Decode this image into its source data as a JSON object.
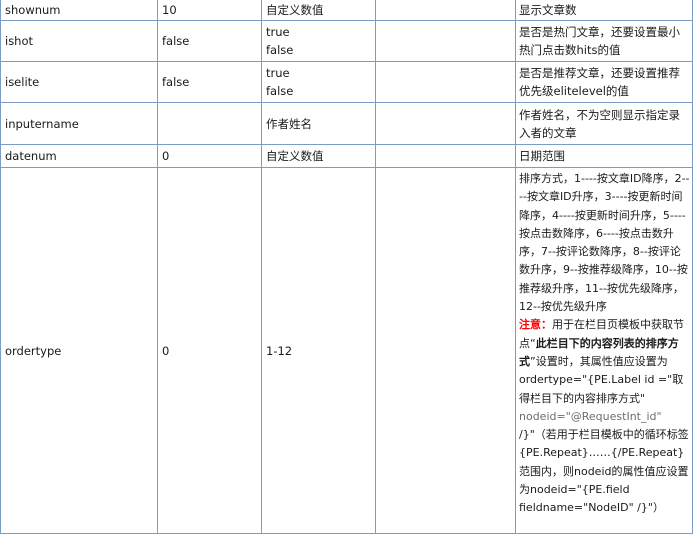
{
  "rows": [
    {
      "name": "shownum",
      "default": "10",
      "values": [
        "自定义数值"
      ],
      "note": "",
      "desc": "显示文章数"
    },
    {
      "name": "ishot",
      "default": "false",
      "values": [
        "true",
        "false"
      ],
      "note": "",
      "desc": "是否是热门文章，还要设置最小热门点击数hits的值"
    },
    {
      "name": "iselite",
      "default": "false",
      "values": [
        "true",
        "false"
      ],
      "note": "",
      "desc": "是否是推荐文章，还要设置推荐优先级elitelevel的值"
    },
    {
      "name": "inputername",
      "default": "",
      "values": [
        "作者姓名"
      ],
      "note": "",
      "desc": "作者姓名，不为空则显示指定录入者的文章"
    },
    {
      "name": "datenum",
      "default": "0",
      "values": [
        "自定义数值"
      ],
      "note": "",
      "desc": "日期范围"
    },
    {
      "name": "ordertype",
      "default": "0",
      "values": [
        "1-12"
      ],
      "note": "",
      "desc": "排序方式，1----按文章ID降序，2----按文章ID升序，3----按更新时间降序，4----按更新时间升序，5----按点击数降序，6----按点击数升序，7--按评论数降序，8--按评论数升序，9--按推荐级降序，10--按推荐级升序，11--按优先级降序，12--按优先级升序",
      "attention_label": "注意：",
      "attention_text_1": "用于在栏目页模板中获取节点“",
      "attention_bold": "此栏目下的内容列表的排序方式",
      "attention_text_2": "”设置时，其属性值应设置为ordertype=\"{PE.Label id =\"取得栏目下的内容排序方式\" ",
      "attention_gray": "nodeid=\"@RequestInt_id\"",
      "attention_text_3": " /}\"（若用于栏目模板中的循环标签{PE.Repeat}……{/PE.Repeat}范围内，则nodeid的属性值应设置为nodeid=\"{PE.field fieldname=\"NodeID\" /}\"）"
    }
  ]
}
